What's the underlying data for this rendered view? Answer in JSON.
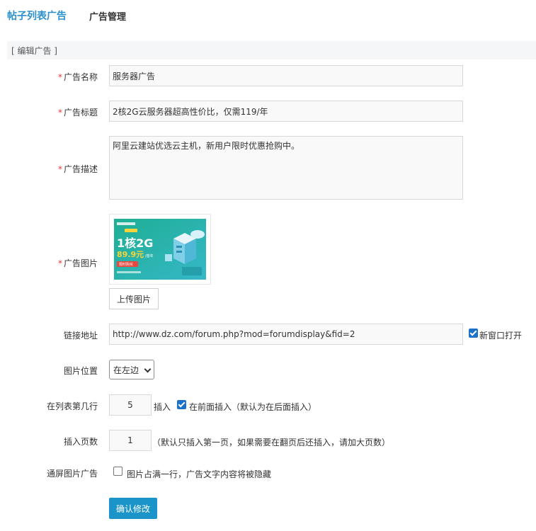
{
  "nav": {
    "list_link": "帖子列表广告",
    "manage_link": "广告管理"
  },
  "section": {
    "title": "[ 编辑广告 ]"
  },
  "required_mark": "*",
  "fields": {
    "name": {
      "label": "广告名称",
      "value": "服务器广告"
    },
    "title": {
      "label": "广告标题",
      "value": "2核2G云服务器超高性价比，仅需119/年"
    },
    "desc": {
      "label": "广告描述",
      "value": "阿里云建站优选云主机，新用户限时优惠抢购中。"
    },
    "image": {
      "label": "广告图片",
      "upload_label": "上传图片",
      "ad_text": {
        "headline": "1核2G",
        "price": "89.9元",
        "per_year": "/首年",
        "cta": "限时购买"
      }
    },
    "link": {
      "label": "链接地址",
      "value": "http://www.dz.com/forum.php?mod=forumdisplay&fid=2",
      "new_window_label": "新窗口打开",
      "new_window_checked": true
    },
    "position": {
      "label": "图片位置",
      "selected": "在左边"
    },
    "row": {
      "label": "在列表第几行",
      "value": "5",
      "insert_label": "插入",
      "before_label": "在前面插入（默认为在后面插入）",
      "before_checked": true
    },
    "pages": {
      "label": "插入页数",
      "value": "1",
      "hint": "（默认只插入第一页，如果需要在翻页后还插入，请加大页数）"
    },
    "fullscreen": {
      "label": "通屏图片广告",
      "option_label": "图片占满一行，广告文字内容将被隐藏",
      "checked": false
    }
  },
  "submit_label": "确认修改",
  "colors": {
    "accent": "#2b8fcb",
    "button": "#1b95c9",
    "required": "#e4393c",
    "checkbox": "#1a73c8"
  }
}
